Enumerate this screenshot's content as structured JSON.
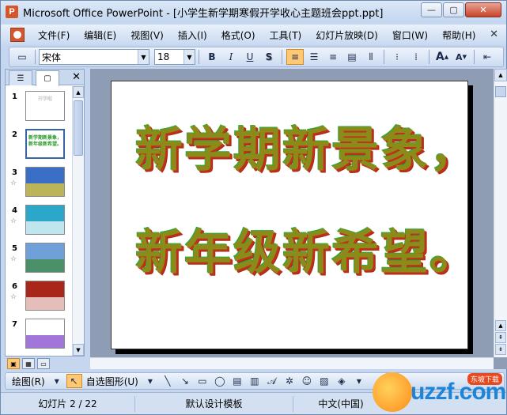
{
  "window": {
    "title": "Microsoft Office PowerPoint - [小学生新学期寒假开学收心主题班会ppt.ppt]",
    "icon_letter": "P",
    "buttons": {
      "minimize": "—",
      "maximize": "▢",
      "close": "✕"
    }
  },
  "menubar": {
    "items": [
      "文件(F)",
      "编辑(E)",
      "视图(V)",
      "插入(I)",
      "格式(O)",
      "工具(T)",
      "幻灯片放映(D)",
      "窗口(W)",
      "帮助(H)"
    ],
    "close_glyph": "✕"
  },
  "toolbar": {
    "font_name": "宋体",
    "font_size": "18",
    "bold": "B",
    "italic": "I",
    "underline": "U",
    "shadow": "S",
    "increase_font": "A",
    "decrease_font": "A",
    "active_button": "align-left"
  },
  "pane": {
    "close_glyph": "✕",
    "slides": [
      {
        "num": "1",
        "thumb_text": "开学啦",
        "bg": "#ffffff",
        "fg": "#c9c9c9",
        "star": ""
      },
      {
        "num": "2",
        "thumb_text": "新学期新景象，新年级新希望。",
        "bg": "#ffffff",
        "fg": "#2a9a2a",
        "star": "",
        "selected": true
      },
      {
        "num": "3",
        "thumb_text": "",
        "bg": "#3b6ec7",
        "fg": "#f2d22a",
        "star": "☆"
      },
      {
        "num": "4",
        "thumb_text": "",
        "bg": "#2aa7c9",
        "fg": "#ffffff",
        "star": "☆"
      },
      {
        "num": "5",
        "thumb_text": "",
        "bg": "#6fa0d8",
        "fg": "#3a8a3a",
        "star": "☆"
      },
      {
        "num": "6",
        "thumb_text": "",
        "bg": "#a8261a",
        "fg": "#ffffff",
        "star": "☆"
      },
      {
        "num": "7",
        "thumb_text": "",
        "bg": "#ffffff",
        "fg": "#7a3ac8",
        "star": ""
      }
    ]
  },
  "slide": {
    "line1": "新学期新景象，",
    "line2": "新年级新希望。"
  },
  "drawbar": {
    "draw_label": "绘图(R)",
    "autoshapes_label": "自选图形(U)"
  },
  "status": {
    "slide_counter": "幻灯片 2 / 22",
    "template": "默认设计模板",
    "language": "中文(中国)"
  },
  "watermark": {
    "text": "uzzf.com",
    "tag": "东坡下载"
  },
  "colors": {
    "accent_active": "#ffc875",
    "title_gradient_top": "#dbe8f7",
    "slide_text": "#8b8b1a",
    "slide_text_shadow": "#c0301a"
  }
}
